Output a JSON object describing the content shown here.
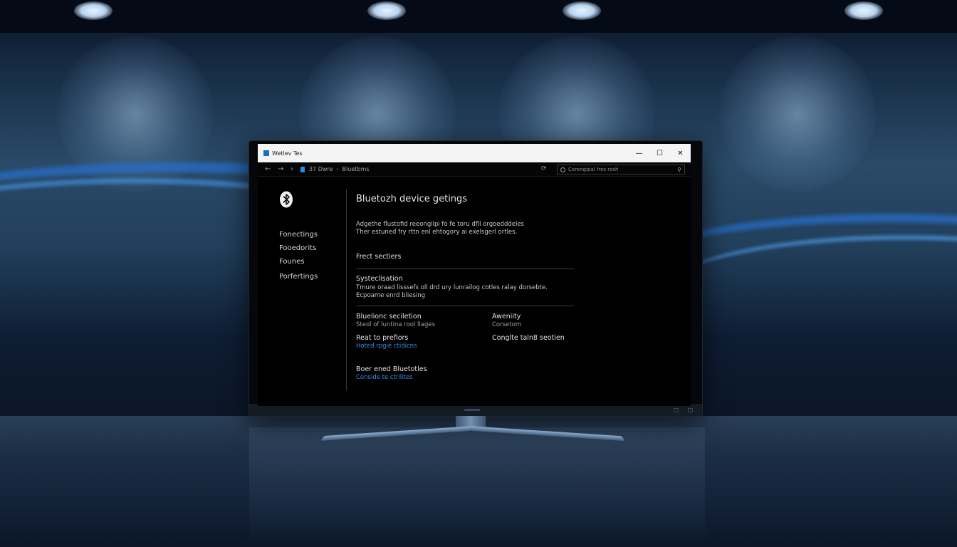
{
  "window": {
    "title": "Wetlev Tes"
  },
  "address_bar": {
    "path": [
      "37 Dwre",
      "Bluetbms"
    ],
    "search_placeholder": "Corengipal fres rosh"
  },
  "sidebar": {
    "items": [
      {
        "label": "Fonectings"
      },
      {
        "label": "Fooedorits"
      },
      {
        "label": "Founes"
      },
      {
        "label": "Porfertings"
      }
    ]
  },
  "content": {
    "title": "Bluetozh device getings",
    "description": [
      "Adgethe flustofid reeongilpi fo fe toru dfll orgoedddeles",
      "Ther estuned fry rttn enl ehtogory ai exelsgerl ortles."
    ],
    "section1": {
      "heading": "Frect sectiers"
    },
    "section2": {
      "heading": "Systeclisation",
      "description": [
        "Tmure oraad lisssefs oll drd ury lunrailog cotles ralay dorsebte.",
        "Ecpoame enrd bliesing"
      ]
    },
    "grid": [
      {
        "heading": "Bluelionc seciletion",
        "sub": "Steol of luntina rool llages",
        "sub_kind": "text"
      },
      {
        "heading": "Aweniity",
        "sub": "Corsetom",
        "sub_kind": "text"
      },
      {
        "heading": "Reat to prefiors",
        "sub": "Hoted rpgie ctidicns",
        "sub_kind": "link"
      },
      {
        "heading": "Conglte taln8 seotien",
        "sub": "",
        "sub_kind": "text"
      }
    ],
    "footer": {
      "heading": "Boer ened Bluetotles",
      "link": "Conside te ctrilites"
    }
  }
}
